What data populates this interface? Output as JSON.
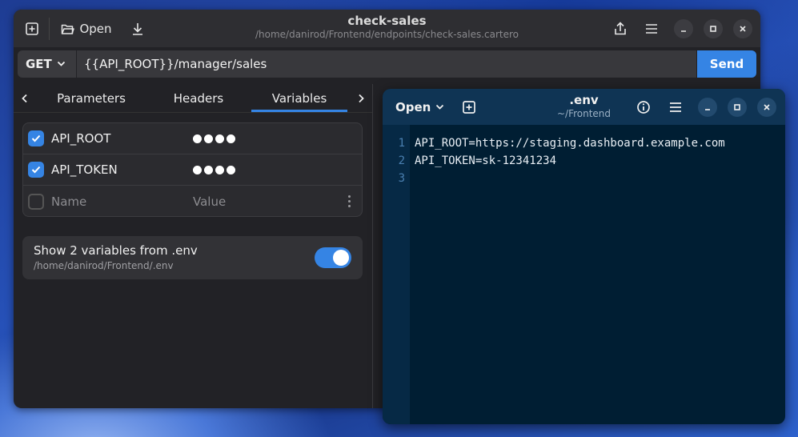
{
  "app": {
    "title": "check-sales",
    "subtitle": "/home/danirod/Frontend/endpoints/check-sales.cartero",
    "open_label": "Open"
  },
  "request": {
    "method": "GET",
    "url": "{{API_ROOT}}/manager/sales",
    "send_label": "Send"
  },
  "tabs": [
    "Parameters",
    "Headers",
    "Variables"
  ],
  "active_tab": "Variables",
  "variables": {
    "rows": [
      {
        "name": "API_ROOT",
        "checked": true,
        "secret": true
      },
      {
        "name": "API_TOKEN",
        "checked": true,
        "secret": true
      }
    ],
    "new_row": {
      "name_placeholder": "Name",
      "value_placeholder": "Value"
    }
  },
  "env_toggle": {
    "title": "Show 2 variables from .env",
    "path": "/home/danirod/Frontend/.env",
    "enabled": true
  },
  "editor": {
    "open_label": "Open",
    "title": ".env",
    "subtitle": "~/Frontend",
    "lines": [
      {
        "n": "1",
        "text": "API_ROOT=https://staging.dashboard.example.com"
      },
      {
        "n": "2",
        "text": "API_TOKEN=sk-12341234"
      },
      {
        "n": "3",
        "text": ""
      }
    ]
  },
  "colors": {
    "accent": "#3584e4",
    "editor_bg": "#001e33",
    "window_bg": "#222226"
  }
}
